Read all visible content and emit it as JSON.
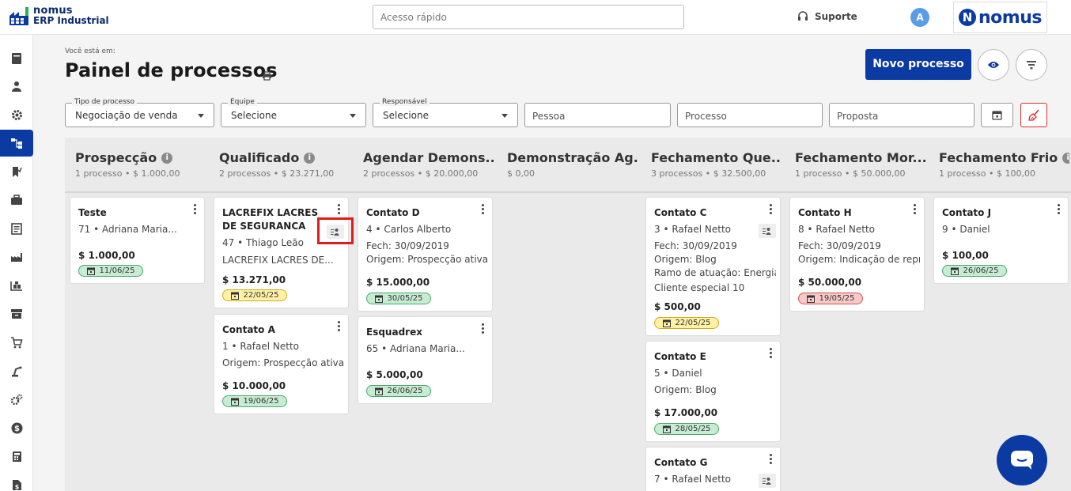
{
  "topbar": {
    "logo_line1": "nomus",
    "logo_line2": "ERP Industrial",
    "quick_placeholder": "Acesso rápido",
    "support_label": "Suporte",
    "avatar_initial": "A",
    "brand_text": "nomus",
    "brand_initial": "N"
  },
  "sidebar": {
    "items": [
      "book",
      "user",
      "gear",
      "process-flow",
      "bookmark",
      "briefcase",
      "document",
      "factory",
      "warehouse",
      "archive",
      "cart",
      "machine",
      "settings-group",
      "money",
      "calculator",
      "file-money"
    ],
    "active": "process-flow"
  },
  "header": {
    "breadcrumb": "Você está em:",
    "title": "Painel de processos",
    "new_button": "Novo processo"
  },
  "filters": {
    "tipo_label": "Tipo de processo",
    "tipo_value": "Negociação de venda",
    "equipe_label": "Equipe",
    "equipe_value": "Selecione",
    "resp_label": "Responsável",
    "resp_value": "Selecione",
    "pessoa_placeholder": "Pessoa",
    "processo_placeholder": "Processo",
    "proposta_placeholder": "Proposta"
  },
  "columns": [
    {
      "title": "Prospecção",
      "info": true,
      "summary": "1 processo • $ 1.000,00"
    },
    {
      "title": "Qualificado",
      "info": true,
      "summary": "2 processos • $ 23.271,00"
    },
    {
      "title": "Agendar Demons...",
      "info": false,
      "summary": "2 processos • $ 20.000,00"
    },
    {
      "title": "Demonstração Ag...",
      "info": false,
      "summary": "$ 0,00"
    },
    {
      "title": "Fechamento Que...",
      "info": false,
      "summary": "3 processos • $ 32.500,00"
    },
    {
      "title": "Fechamento Mor...",
      "info": false,
      "summary": "1 processo • $ 50.000,00"
    },
    {
      "title": "Fechamento Frio",
      "info": true,
      "summary": "1 processo • $ 100,00"
    }
  ],
  "cards": {
    "teste": {
      "name": "Teste",
      "l1": "71 • Adriana Maria...",
      "amount": "$ 1.000,00",
      "date": "11/06/25",
      "status": "green"
    },
    "lacrefix": {
      "name": "LACREFIX LACRES DE SEGURANCA",
      "l1": "47 • Thiago Leão",
      "l2": "LACREFIX LACRES DE...",
      "amount": "$ 13.271,00",
      "date": "22/05/25",
      "status": "yellow"
    },
    "contato_a": {
      "name": "Contato A",
      "l1": "1 • Rafael Netto",
      "l2": "Origem: Prospecção ativa p",
      "amount": "$ 10.000,00",
      "date": "19/06/25",
      "status": "green"
    },
    "contato_d": {
      "name": "Contato D",
      "l1": "4 • Carlos Alberto",
      "l2": "Fech: 30/09/2019",
      "l3": "Origem: Prospecção ativa p",
      "amount": "$ 15.000,00",
      "date": "30/05/25",
      "status": "green"
    },
    "esquadrex": {
      "name": "Esquadrex",
      "l1": "65 • Adriana Maria...",
      "amount": "$ 5.000,00",
      "date": "26/06/25",
      "status": "green"
    },
    "contato_c": {
      "name": "Contato C",
      "l1": "3 • Rafael Netto",
      "l2": "Fech: 30/09/2019",
      "l3": "Origem: Blog",
      "l4": "Ramo de atuação: Energia",
      "l5": "Cliente especial 10",
      "amount": "$ 500,00",
      "date": "22/05/25",
      "status": "yellow"
    },
    "contato_e": {
      "name": "Contato E",
      "l1": "5 • Daniel",
      "l2": "Origem: Blog",
      "amount": "$ 17.000,00",
      "date": "28/05/25",
      "status": "green"
    },
    "contato_g": {
      "name": "Contato G",
      "l1": "7 • Rafael Netto"
    },
    "contato_h": {
      "name": "Contato H",
      "l1": "8 • Rafael Netto",
      "l2": "Fech: 30/09/2019",
      "l3": "Origem: Indicação de repre",
      "amount": "$ 50.000,00",
      "date": "19/05/25",
      "status": "red"
    },
    "contato_j": {
      "name": "Contato J",
      "l1": "9 • Daniel",
      "amount": "$ 100,00",
      "date": "26/06/25",
      "status": "green"
    }
  }
}
